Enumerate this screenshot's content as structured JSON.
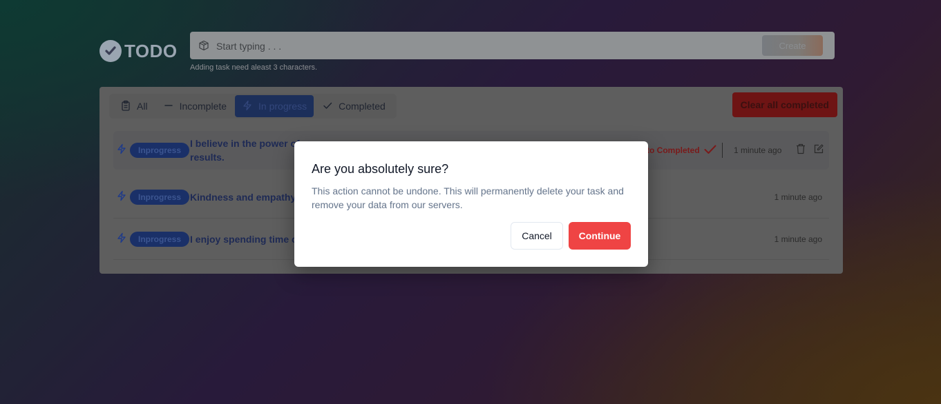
{
  "header": {
    "logo_text": "TODO",
    "search_placeholder": "Start typing . . .",
    "search_value": "",
    "create_label": "Create",
    "hint": "Adding task need aleast 3 characters."
  },
  "filters": {
    "tabs": [
      {
        "label": "All",
        "icon": "clipboard-icon"
      },
      {
        "label": "Incomplete",
        "icon": "minus-icon"
      },
      {
        "label": "In progress",
        "icon": "bolt-icon",
        "active": true
      },
      {
        "label": "Completed",
        "icon": "check-icon"
      }
    ],
    "clear_label": "Clear all completed"
  },
  "tasks": [
    {
      "status": "Inprogress",
      "text": "I believe in the power of ... results.",
      "text_line1": "I believe in the power of",
      "text_line2": "results.",
      "mark_label": "to Completed",
      "time": "1 minute ago"
    },
    {
      "status": "Inprogress",
      "text": "Kindness and empathy a",
      "time": "1 minute ago"
    },
    {
      "status": "Inprogress",
      "text": "I enjoy spending time o",
      "time": "1 minute ago"
    }
  ],
  "dialog": {
    "title": "Are you absolutely sure?",
    "description": "This action cannot be undone. This will permanently delete your task and remove your data from our servers.",
    "cancel_label": "Cancel",
    "continue_label": "Continue"
  },
  "colors": {
    "continue": "#ef4444",
    "badge": "#1a3068",
    "clear": "#6e1414"
  }
}
